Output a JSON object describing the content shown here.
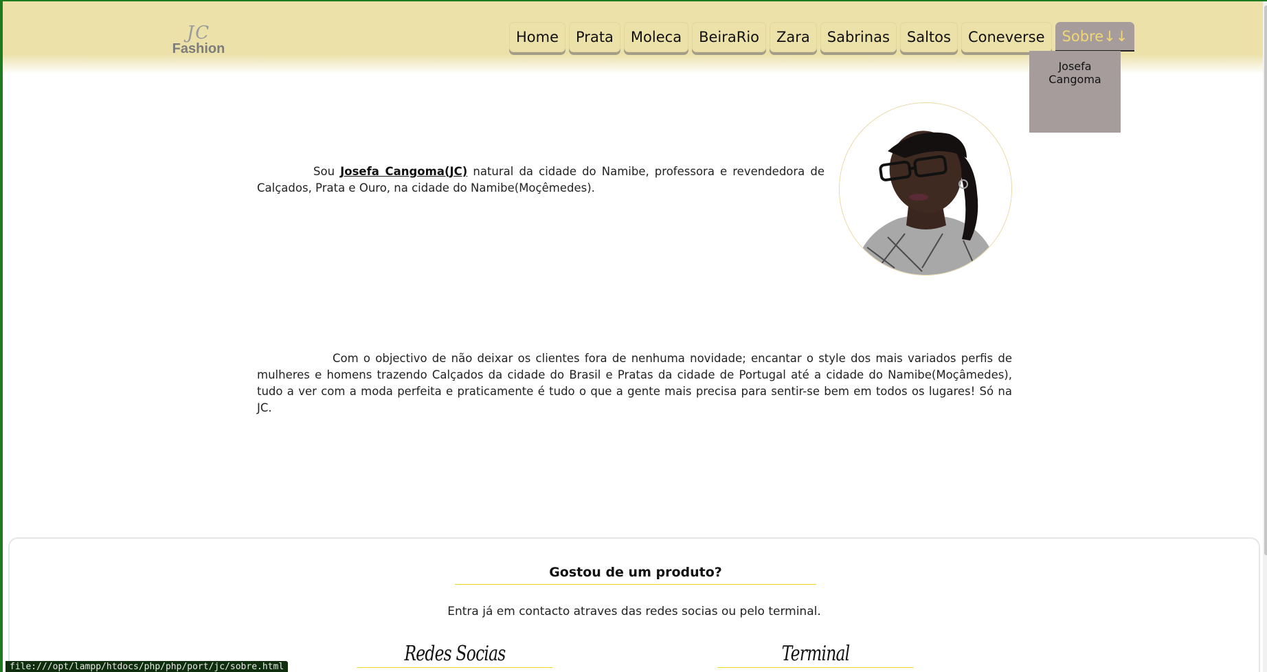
{
  "logo": {
    "mark": "JC",
    "text": "Fashion"
  },
  "nav": {
    "items": [
      "Home",
      "Prata",
      "Moleca",
      "BeiraRio",
      "Zara",
      "Sabrinas",
      "Saltos",
      "Coneverse"
    ],
    "active_label": "Sobre↓↓",
    "dropdown_item": "Josefa Cangoma"
  },
  "intro": {
    "prefix": "Sou ",
    "name": "Josefa Cangoma(JC)",
    "suffix": " natural da cidade do Namibe, professora e revendedora de Calçados, Prata e Ouro, na cidade do Namibe(Moçêmedes)."
  },
  "mission": "Com o objectivo de não deixar os clientes fora de nenhuma novidade; encantar o style dos mais variados perfis de mulheres e homens trazendo Calçados da cidade do Brasil e Pratas da cidade de Portugal até a cidade do Namibe(Moçâmedes), tudo a ver com a moda perfeita e praticamente é tudo o que a gente mais precisa para sentir-se bem em todos os lugares! Só na JC.",
  "footer": {
    "title": "Gostou de um produto?",
    "text": "Entra já em contacto atraves das redes socias ou pelo terminal.",
    "social_title": "Redes Socias",
    "terminal_title": "Terminal"
  },
  "status_url": "file:///opt/lampp/htdocs/php/php/port/jc/sobre.html",
  "colors": {
    "header": "#ece1a9",
    "active": "#a69c9c",
    "active_text": "#f1d875",
    "accent_line": "#f0d820"
  }
}
